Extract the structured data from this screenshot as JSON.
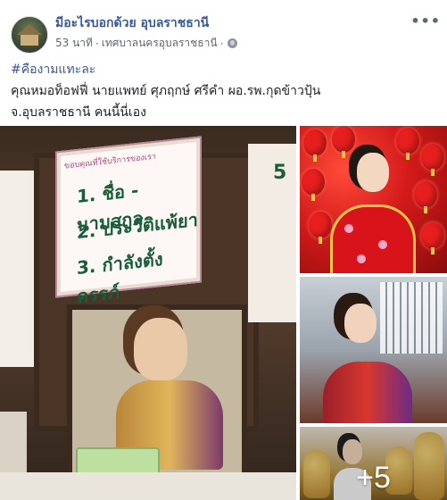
{
  "post": {
    "page_name": "มีอะไรบอกด้วย อุบลราชธานี",
    "time": "53 นาที",
    "separator": "·",
    "location": "เทศบาลนครอุบลราชธานี",
    "separator2": "·",
    "more_label": "•••"
  },
  "text": {
    "hashtag": "#คืองามแทะละ",
    "line1": "คุณหมอท็อฟฟี่ นายแพทย์ ศุภฤกษ์ ศรีคำ ผอ.รพ.กุดข้าวปุ้น",
    "line2": "จ.อุบลราชธานี คนนี้นี่เอง"
  },
  "photos": {
    "main_sign": {
      "header": "ขอบคุณที่ใช้บริการของเรา",
      "item1": "1. ชื่อ - นามสกุล",
      "item2": "2. ประวัติแพ้ยา",
      "item3": "3. กำลังตั้งครรภ์",
      "side_number": "5"
    },
    "more_count": "+5"
  }
}
